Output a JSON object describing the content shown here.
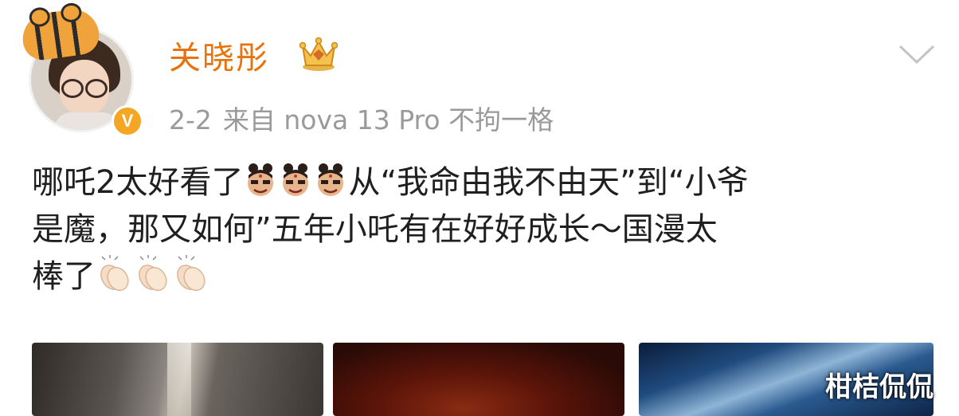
{
  "post": {
    "author": {
      "name": "关晓彤",
      "verified_mark": "V",
      "avatar_icon": "avatar-girl-glasses-tiger",
      "crown_icon": "gold-crown-icon"
    },
    "meta": {
      "date": "2-2",
      "source": "来自 nova 13 Pro 不拘一格"
    },
    "menu_icon": "chevron-down-icon",
    "text_lines": [
      {
        "before": "哪吒2太好看了",
        "emojis": [
          "nezha-face",
          "nezha-face",
          "nezha-face"
        ],
        "after": "从“我命由我不由天”到“小爷"
      },
      {
        "before": "是魔，那又如何”五年小吒有在好好成长～国漫太",
        "emojis": [],
        "after": ""
      },
      {
        "before": "棒了",
        "emojis": [
          "clapping-hands",
          "clapping-hands",
          "clapping-hands"
        ],
        "after": ""
      }
    ],
    "thumbnails": [
      "image-1",
      "image-2",
      "image-3"
    ]
  },
  "watermark": "柑桔侃侃",
  "colors": {
    "username": "#e8730c",
    "meta": "#9a9a9a",
    "text": "#1f1f1f",
    "verified": "#f5a623"
  }
}
